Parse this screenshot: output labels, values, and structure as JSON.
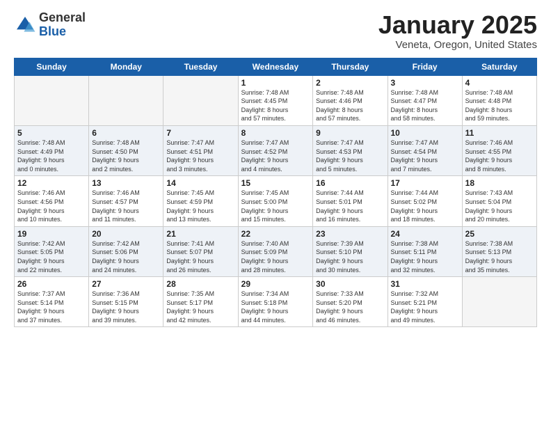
{
  "logo": {
    "general": "General",
    "blue": "Blue"
  },
  "title": "January 2025",
  "subtitle": "Veneta, Oregon, United States",
  "headers": [
    "Sunday",
    "Monday",
    "Tuesday",
    "Wednesday",
    "Thursday",
    "Friday",
    "Saturday"
  ],
  "weeks": [
    [
      {
        "day": "",
        "info": ""
      },
      {
        "day": "",
        "info": ""
      },
      {
        "day": "",
        "info": ""
      },
      {
        "day": "1",
        "info": "Sunrise: 7:48 AM\nSunset: 4:45 PM\nDaylight: 8 hours\nand 57 minutes."
      },
      {
        "day": "2",
        "info": "Sunrise: 7:48 AM\nSunset: 4:46 PM\nDaylight: 8 hours\nand 57 minutes."
      },
      {
        "day": "3",
        "info": "Sunrise: 7:48 AM\nSunset: 4:47 PM\nDaylight: 8 hours\nand 58 minutes."
      },
      {
        "day": "4",
        "info": "Sunrise: 7:48 AM\nSunset: 4:48 PM\nDaylight: 8 hours\nand 59 minutes."
      }
    ],
    [
      {
        "day": "5",
        "info": "Sunrise: 7:48 AM\nSunset: 4:49 PM\nDaylight: 9 hours\nand 0 minutes."
      },
      {
        "day": "6",
        "info": "Sunrise: 7:48 AM\nSunset: 4:50 PM\nDaylight: 9 hours\nand 2 minutes."
      },
      {
        "day": "7",
        "info": "Sunrise: 7:47 AM\nSunset: 4:51 PM\nDaylight: 9 hours\nand 3 minutes."
      },
      {
        "day": "8",
        "info": "Sunrise: 7:47 AM\nSunset: 4:52 PM\nDaylight: 9 hours\nand 4 minutes."
      },
      {
        "day": "9",
        "info": "Sunrise: 7:47 AM\nSunset: 4:53 PM\nDaylight: 9 hours\nand 5 minutes."
      },
      {
        "day": "10",
        "info": "Sunrise: 7:47 AM\nSunset: 4:54 PM\nDaylight: 9 hours\nand 7 minutes."
      },
      {
        "day": "11",
        "info": "Sunrise: 7:46 AM\nSunset: 4:55 PM\nDaylight: 9 hours\nand 8 minutes."
      }
    ],
    [
      {
        "day": "12",
        "info": "Sunrise: 7:46 AM\nSunset: 4:56 PM\nDaylight: 9 hours\nand 10 minutes."
      },
      {
        "day": "13",
        "info": "Sunrise: 7:46 AM\nSunset: 4:57 PM\nDaylight: 9 hours\nand 11 minutes."
      },
      {
        "day": "14",
        "info": "Sunrise: 7:45 AM\nSunset: 4:59 PM\nDaylight: 9 hours\nand 13 minutes."
      },
      {
        "day": "15",
        "info": "Sunrise: 7:45 AM\nSunset: 5:00 PM\nDaylight: 9 hours\nand 15 minutes."
      },
      {
        "day": "16",
        "info": "Sunrise: 7:44 AM\nSunset: 5:01 PM\nDaylight: 9 hours\nand 16 minutes."
      },
      {
        "day": "17",
        "info": "Sunrise: 7:44 AM\nSunset: 5:02 PM\nDaylight: 9 hours\nand 18 minutes."
      },
      {
        "day": "18",
        "info": "Sunrise: 7:43 AM\nSunset: 5:04 PM\nDaylight: 9 hours\nand 20 minutes."
      }
    ],
    [
      {
        "day": "19",
        "info": "Sunrise: 7:42 AM\nSunset: 5:05 PM\nDaylight: 9 hours\nand 22 minutes."
      },
      {
        "day": "20",
        "info": "Sunrise: 7:42 AM\nSunset: 5:06 PM\nDaylight: 9 hours\nand 24 minutes."
      },
      {
        "day": "21",
        "info": "Sunrise: 7:41 AM\nSunset: 5:07 PM\nDaylight: 9 hours\nand 26 minutes."
      },
      {
        "day": "22",
        "info": "Sunrise: 7:40 AM\nSunset: 5:09 PM\nDaylight: 9 hours\nand 28 minutes."
      },
      {
        "day": "23",
        "info": "Sunrise: 7:39 AM\nSunset: 5:10 PM\nDaylight: 9 hours\nand 30 minutes."
      },
      {
        "day": "24",
        "info": "Sunrise: 7:38 AM\nSunset: 5:11 PM\nDaylight: 9 hours\nand 32 minutes."
      },
      {
        "day": "25",
        "info": "Sunrise: 7:38 AM\nSunset: 5:13 PM\nDaylight: 9 hours\nand 35 minutes."
      }
    ],
    [
      {
        "day": "26",
        "info": "Sunrise: 7:37 AM\nSunset: 5:14 PM\nDaylight: 9 hours\nand 37 minutes."
      },
      {
        "day": "27",
        "info": "Sunrise: 7:36 AM\nSunset: 5:15 PM\nDaylight: 9 hours\nand 39 minutes."
      },
      {
        "day": "28",
        "info": "Sunrise: 7:35 AM\nSunset: 5:17 PM\nDaylight: 9 hours\nand 42 minutes."
      },
      {
        "day": "29",
        "info": "Sunrise: 7:34 AM\nSunset: 5:18 PM\nDaylight: 9 hours\nand 44 minutes."
      },
      {
        "day": "30",
        "info": "Sunrise: 7:33 AM\nSunset: 5:20 PM\nDaylight: 9 hours\nand 46 minutes."
      },
      {
        "day": "31",
        "info": "Sunrise: 7:32 AM\nSunset: 5:21 PM\nDaylight: 9 hours\nand 49 minutes."
      },
      {
        "day": "",
        "info": ""
      }
    ]
  ]
}
